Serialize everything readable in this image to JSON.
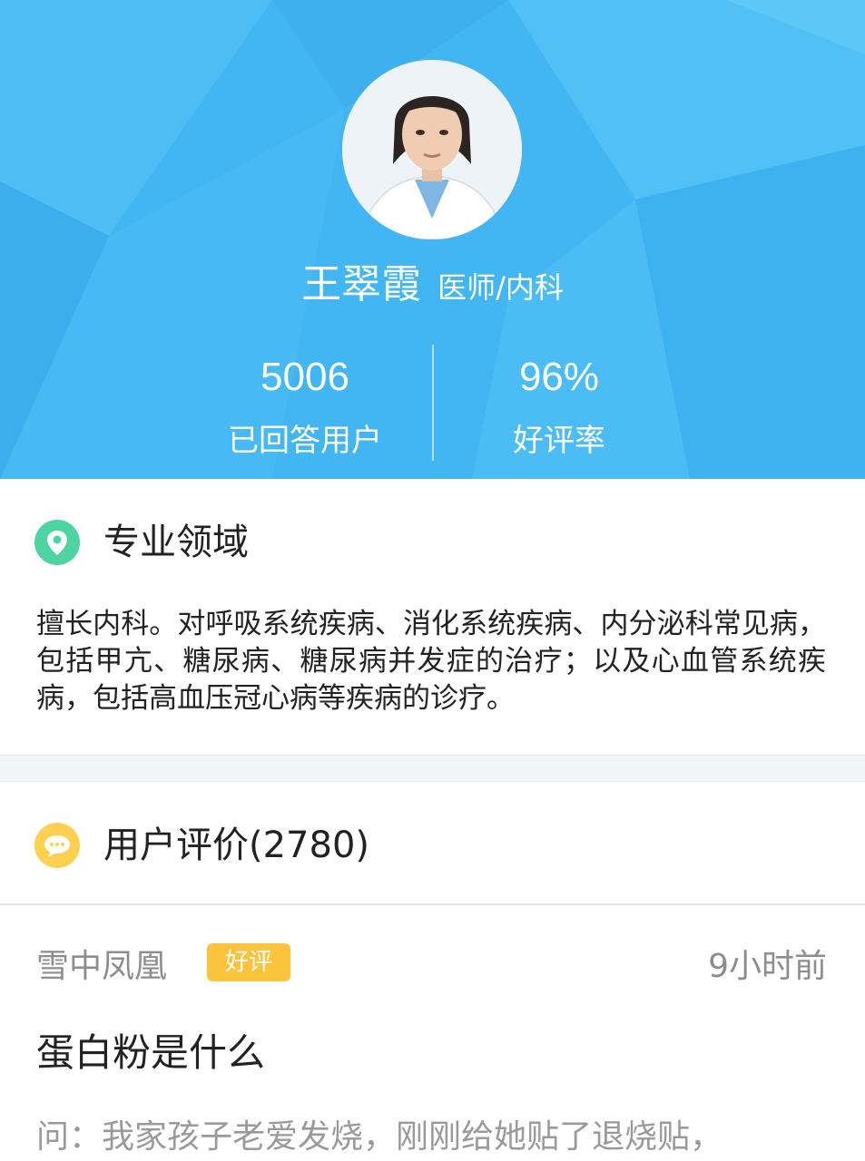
{
  "profile": {
    "name": "王翠霞",
    "title": "医师/内科",
    "avatar_icon": "doctor-portrait"
  },
  "stats": {
    "answered": {
      "value": "5006",
      "label": "已回答用户"
    },
    "rating": {
      "value": "96%",
      "label": "好评率"
    }
  },
  "expertise": {
    "icon": "location-pin-icon",
    "heading": "专业领域",
    "body": "擅长内科。对呼吸系统疾病、消化系统疾病、内分泌科常见病，包括甲亢、糖尿病、糖尿病并发症的治疗；以及心血管系统疾病，包括高血压冠心病等疾病的诊疗。"
  },
  "reviews": {
    "icon": "chat-bubble-icon",
    "heading": "用户评价(2780)",
    "items": [
      {
        "user": "雪中凤凰",
        "badge": "好评",
        "time": "9小时前",
        "title": "蛋白粉是什么",
        "question": "问：我家孩子老爱发烧，刚刚给她贴了退烧贴，"
      }
    ]
  },
  "colors": {
    "header_bg": "#42b6f2",
    "expertise_icon": "#4dd4a2",
    "reviews_icon": "#fdd14f",
    "badge": "#fbc43c"
  }
}
